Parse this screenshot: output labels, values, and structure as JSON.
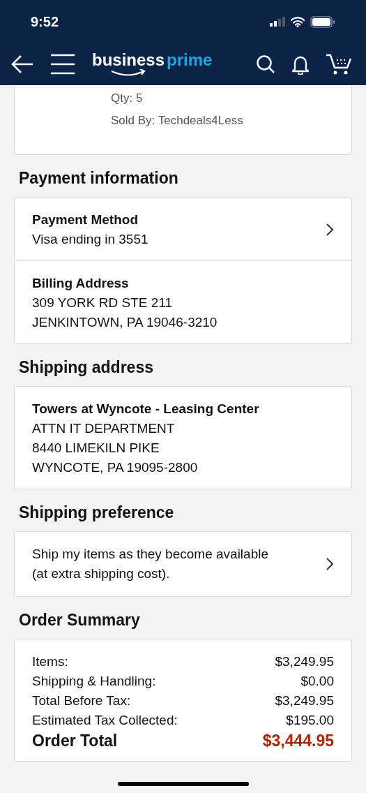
{
  "status_bar": {
    "time": "9:52"
  },
  "nav": {
    "logo": {
      "word_1": "business",
      "word_2": "prime"
    }
  },
  "item_card": {
    "lines": [
      "Qty: 5",
      "Sold By: Techdeals4Less"
    ]
  },
  "payment": {
    "title": "Payment information",
    "rows": [
      {
        "heading": "Payment Method",
        "lines": [
          "Visa ending in 3551"
        ],
        "chevron": true
      },
      {
        "heading": "Billing Address",
        "lines": [
          "309 YORK RD STE 211",
          "JENKINTOWN, PA 19046-3210"
        ],
        "chevron": false
      }
    ]
  },
  "shipping_address": {
    "title": "Shipping address",
    "heading": "Towers at Wyncote - Leasing Center",
    "lines": [
      "ATTN IT DEPARTMENT",
      "8440 LIMEKILN PIKE",
      "WYNCOTE, PA 19095-2800"
    ]
  },
  "shipping_preference": {
    "title": "Shipping preference",
    "text": "Ship my items as they become available (at extra shipping cost)."
  },
  "order_summary": {
    "title": "Order Summary",
    "rows": [
      {
        "kind": "line",
        "label": "Items:",
        "value": "$3,249.95"
      },
      {
        "kind": "line",
        "label": "Shipping & Handling:",
        "value": "$0.00"
      },
      {
        "kind": "line",
        "label": "Total Before Tax:",
        "value": "$3,249.95"
      },
      {
        "kind": "line",
        "label": "Estimated Tax Collected:",
        "value": "$195.00"
      },
      {
        "kind": "total",
        "label": "Order Total",
        "value": "$3,444.95"
      }
    ]
  }
}
